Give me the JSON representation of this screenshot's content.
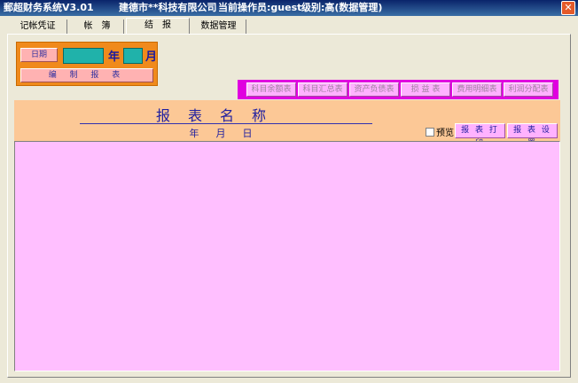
{
  "titlebar": {
    "app": "郵超财务系统V3.01",
    "company": "建德市**科技有限公司",
    "operator": "当前操作员:guest",
    "level": "级别:高(数据管理)"
  },
  "tabs": [
    "记帐凭证",
    "帐　簿",
    "结　报",
    "数据管理"
  ],
  "date": {
    "button": "日期",
    "year_label": "年",
    "month_label": "月",
    "compile": "编 制 报 表"
  },
  "report_buttons": [
    "科目余额表",
    "科目汇总表",
    "资产负债表",
    "损 益 表",
    "费用明细表",
    "利润分配表"
  ],
  "report": {
    "name": "报表名称",
    "date_line": "年　月　日",
    "preview": "预览",
    "print": "报 表 打 印",
    "settings": "报 表 设 置"
  }
}
